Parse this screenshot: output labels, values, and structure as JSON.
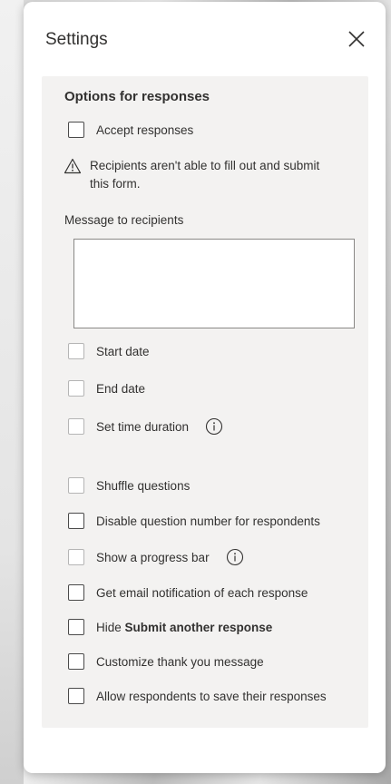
{
  "panel": {
    "title": "Settings",
    "close_icon": "close-icon"
  },
  "options": {
    "section_title": "Options for responses",
    "accept_responses": {
      "label": "Accept responses",
      "checked": false
    },
    "warning": {
      "icon": "warning-icon",
      "text": "Recipients aren't able to fill out and submit this form."
    },
    "message": {
      "label": "Message to recipients",
      "value": ""
    },
    "start_date": {
      "label": "Start date",
      "checked": false
    },
    "end_date": {
      "label": "End date",
      "checked": false
    },
    "set_time_duration": {
      "label": "Set time duration",
      "checked": false,
      "info_icon": "info-icon"
    },
    "shuffle_questions": {
      "label": "Shuffle questions",
      "checked": false
    },
    "disable_question_number": {
      "label": "Disable question number for respondents",
      "checked": false
    },
    "show_progress_bar": {
      "label": "Show a progress bar",
      "checked": false,
      "info_icon": "info-icon"
    },
    "email_notification": {
      "label": "Get email notification of each response",
      "checked": false
    },
    "hide_submit_another": {
      "label_prefix": "Hide ",
      "label_bold": "Submit another response",
      "checked": false
    },
    "customize_thank_you": {
      "label": "Customize thank you message",
      "checked": false
    },
    "allow_save_responses": {
      "label": "Allow respondents to save their responses",
      "checked": false
    }
  },
  "colors": {
    "text": "#323130",
    "card_background": "#f3f2f1",
    "panel_background": "#ffffff",
    "checkbox_border": "#4a4a4a",
    "checkbox_border_disabled": "#b5b5b5"
  }
}
